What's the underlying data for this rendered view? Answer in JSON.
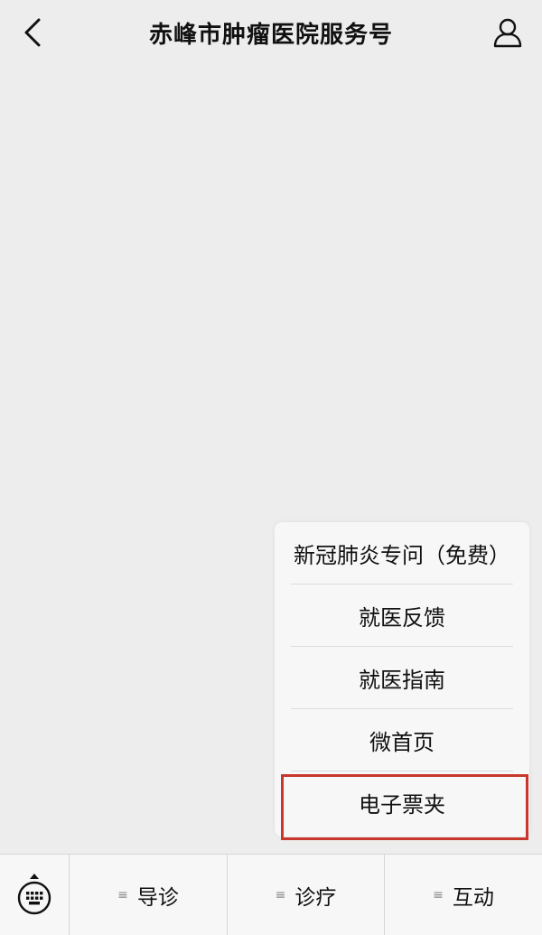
{
  "header": {
    "title": "赤峰市肿瘤医院服务号",
    "back_icon": "chevron-left-icon",
    "profile_icon": "person-icon"
  },
  "popup_menu": {
    "items": [
      {
        "label": "新冠肺炎专问（免费）"
      },
      {
        "label": "就医反馈"
      },
      {
        "label": "就医指南"
      },
      {
        "label": "微首页"
      },
      {
        "label": "电子票夹"
      }
    ],
    "highlighted_item": "电子票夹"
  },
  "bottom_bar": {
    "keyboard_icon": "keyboard-icon",
    "tabs": [
      {
        "label": "导诊",
        "icon": "menu-lines-icon"
      },
      {
        "label": "诊疗",
        "icon": "menu-lines-icon"
      },
      {
        "label": "互动",
        "icon": "menu-lines-icon"
      }
    ]
  },
  "colors": {
    "background": "#ededed",
    "menu_background": "#f7f7f7",
    "highlight_border": "#c8372d",
    "text": "#111111"
  }
}
